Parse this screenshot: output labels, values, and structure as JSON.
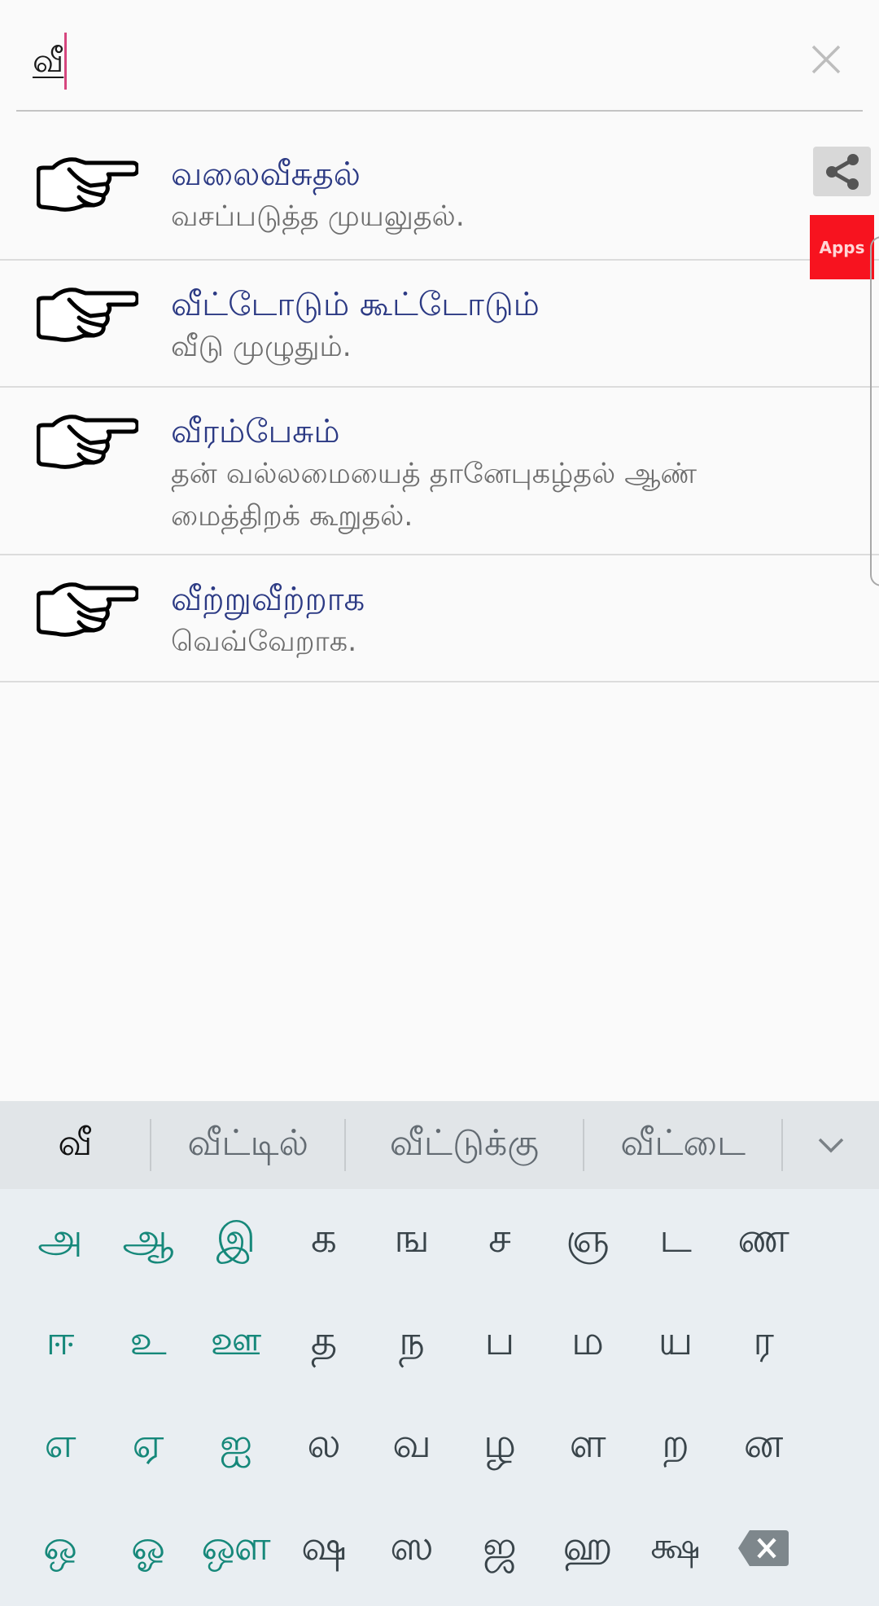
{
  "search": {
    "value": "வீ",
    "clear_icon": "close-icon"
  },
  "results": [
    {
      "icon": "pointing-hand-icon",
      "title": "வலைவீசுதல்",
      "description": "வசப்படுத்த முயலுதல்."
    },
    {
      "icon": "pointing-hand-icon",
      "title": "வீட்டோடும் கூட்டோடும்",
      "description": "வீடு முழுதும்."
    },
    {
      "icon": "pointing-hand-icon",
      "title": "வீரம்பேசும்",
      "description": "தன் வல்லமையைத் தானேபுகழ்தல் ஆண் மைத்திறக் கூறுதல்."
    },
    {
      "icon": "pointing-hand-icon",
      "title": "வீற்றுவீற்றாக",
      "description": "வெவ்வேறாக."
    }
  ],
  "side": {
    "share_icon": "share-icon",
    "apps_label": "Apps"
  },
  "keyboard": {
    "suggestions": {
      "current": "வீ",
      "items": [
        "வீட்டில்",
        "வீட்டுக்கு",
        "வீட்டை"
      ],
      "expand_icon": "chevron-down-icon"
    },
    "rows": [
      [
        {
          "label": "அ",
          "type": "vowel"
        },
        {
          "label": "ஆ",
          "type": "vowel"
        },
        {
          "label": "இ",
          "type": "vowel"
        },
        {
          "label": "க",
          "type": "consonant"
        },
        {
          "label": "ங",
          "type": "consonant"
        },
        {
          "label": "ச",
          "type": "consonant"
        },
        {
          "label": "ஞ",
          "type": "consonant"
        },
        {
          "label": "ட",
          "type": "consonant"
        },
        {
          "label": "ண",
          "type": "consonant"
        }
      ],
      [
        {
          "label": "ஈ",
          "type": "vowel"
        },
        {
          "label": "உ",
          "type": "vowel"
        },
        {
          "label": "ஊ",
          "type": "vowel"
        },
        {
          "label": "த",
          "type": "consonant"
        },
        {
          "label": "ந",
          "type": "consonant"
        },
        {
          "label": "ப",
          "type": "consonant"
        },
        {
          "label": "ம",
          "type": "consonant"
        },
        {
          "label": "ய",
          "type": "consonant"
        },
        {
          "label": "ர",
          "type": "consonant"
        }
      ],
      [
        {
          "label": "எ",
          "type": "vowel"
        },
        {
          "label": "ஏ",
          "type": "vowel"
        },
        {
          "label": "ஐ",
          "type": "vowel"
        },
        {
          "label": "ல",
          "type": "consonant"
        },
        {
          "label": "வ",
          "type": "consonant"
        },
        {
          "label": "ழ",
          "type": "consonant"
        },
        {
          "label": "ள",
          "type": "consonant"
        },
        {
          "label": "ற",
          "type": "consonant"
        },
        {
          "label": "ன",
          "type": "consonant"
        }
      ],
      [
        {
          "label": "ஒ",
          "type": "vowel"
        },
        {
          "label": "ஓ",
          "type": "vowel"
        },
        {
          "label": "ஔ",
          "type": "vowel"
        },
        {
          "label": "ஷ",
          "type": "consonant"
        },
        {
          "label": "ஸ",
          "type": "consonant"
        },
        {
          "label": "ஜ",
          "type": "consonant"
        },
        {
          "label": "ஹ",
          "type": "consonant"
        },
        {
          "label": "க்ஷ",
          "type": "consonant"
        },
        {
          "label": "",
          "type": "backspace",
          "icon": "backspace-icon"
        }
      ]
    ]
  },
  "colors": {
    "title": "#2c3a84",
    "description": "#6e6e6e",
    "vowel_key": "#16887a",
    "consonant_key": "#39444a",
    "caret": "#d6467e",
    "apps_badge": "#f7131f"
  }
}
